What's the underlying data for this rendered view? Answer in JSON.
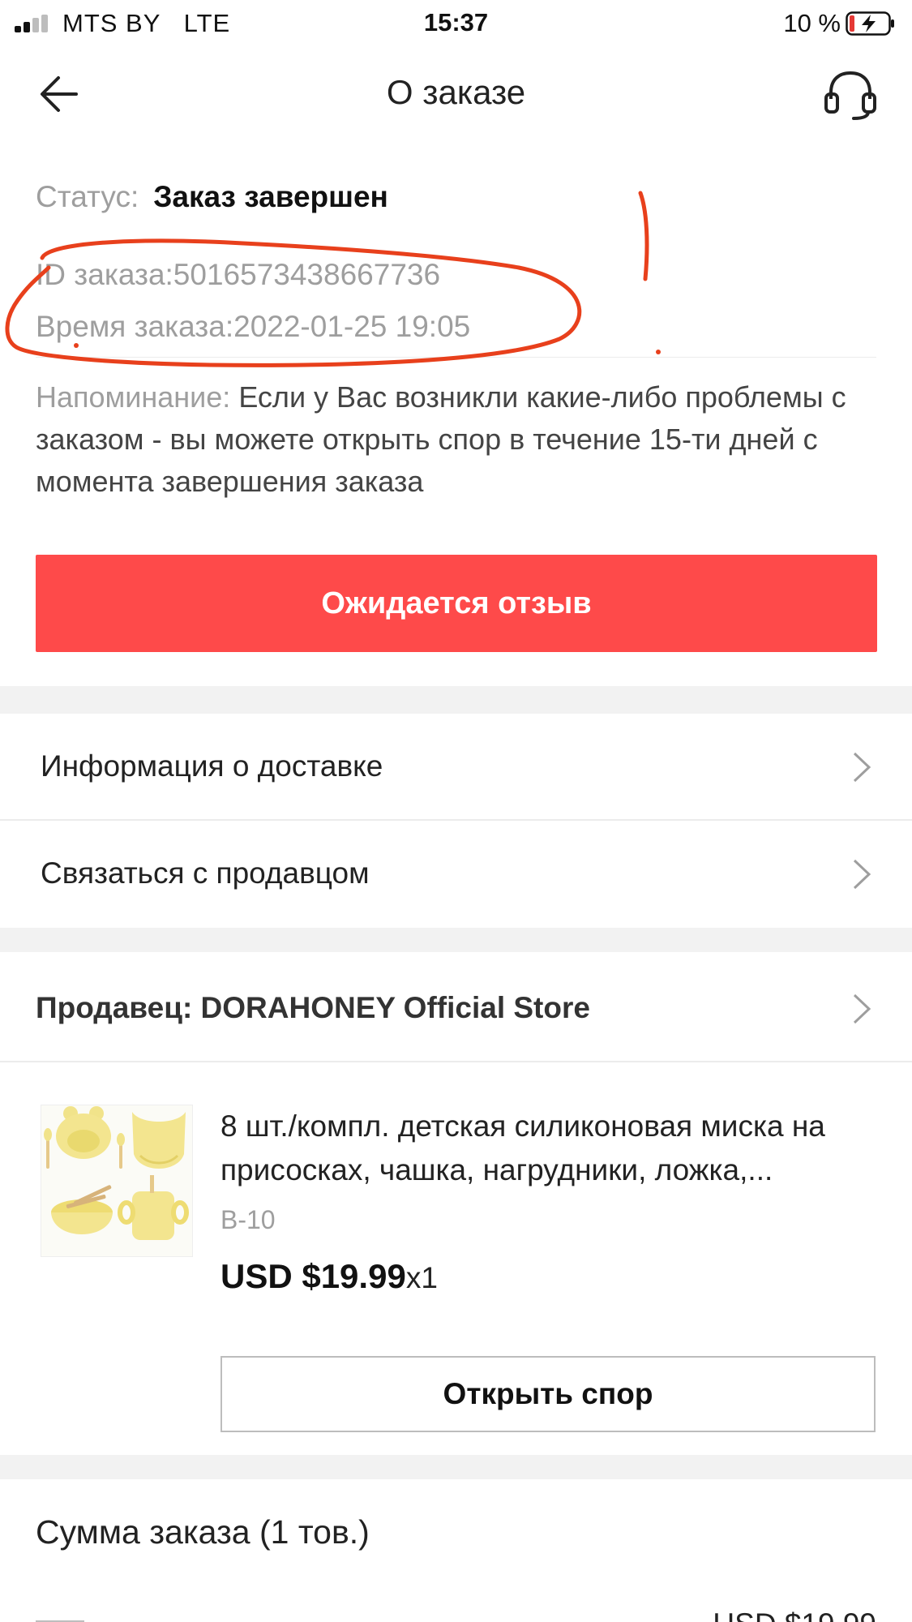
{
  "statusbar": {
    "carrier": "MTS BY   LTE",
    "time": "15:37",
    "battery_percent": "10 %"
  },
  "header": {
    "title": "О заказе",
    "back_icon": "back-arrow-icon",
    "support_icon": "headset-icon"
  },
  "order": {
    "status_label": "Статус:",
    "status_value": "Заказ завершен",
    "id_text": "ID заказа:5016573438667736",
    "time_text": "Время заказа:2022-01-25 19:05",
    "reminder_label": "Напоминание:",
    "reminder_text": "Если у Вас возникли какие-либо проблемы с заказом - вы можете открыть спор в течение 15-ти дней с момента завершения заказа",
    "review_button": "Ожидается отзыв"
  },
  "links": {
    "delivery": "Информация о доставке",
    "contact_seller": "Связаться с продавцом",
    "chevron_icon": "chevron-right-icon"
  },
  "seller": {
    "label": "Продавец: DORAHONEY Official Store"
  },
  "product": {
    "title": "8 шт./компл. детская силиконовая миска на присосках, чашка, нагрудники, ложка,...",
    "sku": "B-10",
    "price": "USD $19.99",
    "quantity": "x1",
    "dispute_button": "Открыть спор",
    "image_icon": "baby-tableware-set-image"
  },
  "summary": {
    "title": "Сумма заказа (1 тов.)",
    "total_partial": "USD $19.99"
  },
  "colors": {
    "accent_red": "#fe4a4a",
    "annotation_red": "#e8401c",
    "section_gap": "#f2f2f2"
  }
}
